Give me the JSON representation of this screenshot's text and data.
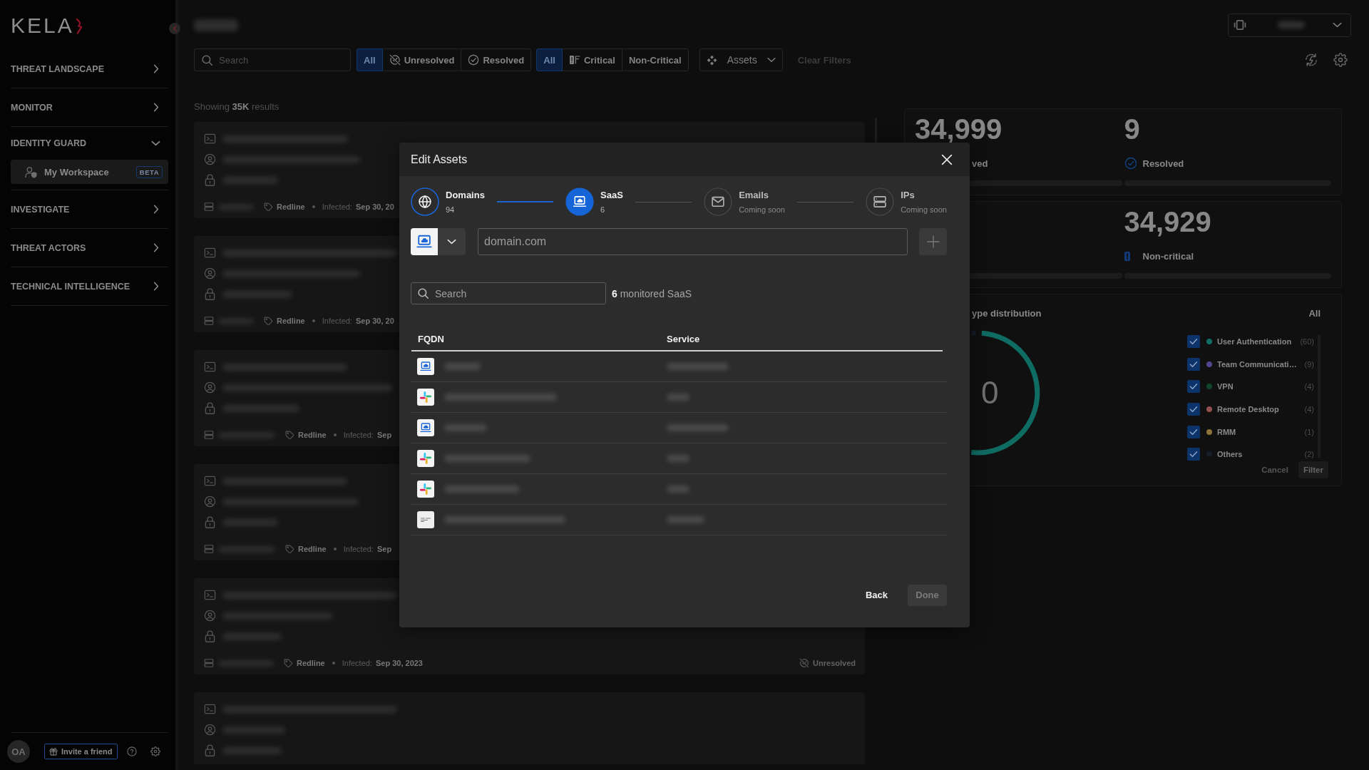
{
  "sidebar": {
    "logo": "KELA",
    "items": [
      {
        "label": "THREAT LANDSCAPE",
        "expanded": false
      },
      {
        "label": "MONITOR",
        "expanded": false
      },
      {
        "label": "IDENTITY GUARD",
        "expanded": true,
        "children": [
          {
            "label": "My Workspace",
            "badge": "BETA",
            "selected": true
          }
        ]
      },
      {
        "label": "INVESTIGATE",
        "expanded": false
      },
      {
        "label": "THREAT ACTORS",
        "expanded": false
      },
      {
        "label": "TECHNICAL INTELLIGENCE",
        "expanded": false
      }
    ],
    "footer": {
      "avatar": "OA",
      "invite": "Invite a friend"
    }
  },
  "filters": {
    "search": {
      "placeholder": "Search"
    },
    "status": [
      {
        "label": "All",
        "kind": "text",
        "selected": true
      },
      {
        "label": "Unresolved",
        "kind": "unresolved",
        "selected": false
      },
      {
        "label": "Resolved",
        "kind": "resolved",
        "selected": false
      }
    ],
    "severity": [
      {
        "label": "All",
        "kind": "text",
        "selected": true
      },
      {
        "label": "Critical",
        "kind": "critical",
        "selected": false
      },
      {
        "label": "Non-Critical",
        "kind": "text",
        "selected": false
      }
    ],
    "assets": {
      "label": "Assets"
    },
    "clear": {
      "label": "Clear Filters",
      "disabled": true
    }
  },
  "results": {
    "summary": "Showing **35K** results",
    "cards": [
      {
        "fields": [
          {
            "kind": "link"
          },
          {
            "kind": "account"
          },
          {
            "kind": "password"
          }
        ],
        "footer": {
          "source": "Redline",
          "infected_label": "Infected:",
          "infected_date": "Sep 30, 20"
        }
      },
      {
        "fields": [
          {
            "kind": "link"
          },
          {
            "kind": "account"
          },
          {
            "kind": "password"
          }
        ],
        "footer": {
          "source": "Redline",
          "infected_label": "Infected:",
          "infected_date": "Sep 30, 20"
        }
      },
      {
        "fields": [
          {
            "kind": "link"
          },
          {
            "kind": "account"
          },
          {
            "kind": "password"
          }
        ],
        "footer": {
          "source": "Redline",
          "infected_label": "Infected:",
          "infected_date": "Sep"
        }
      },
      {
        "fields": [
          {
            "kind": "link"
          },
          {
            "kind": "account"
          },
          {
            "kind": "password"
          }
        ],
        "footer": {
          "source": "Redline",
          "infected_label": "Infected:",
          "infected_date": "Sep"
        }
      },
      {
        "fields": [
          {
            "kind": "link"
          },
          {
            "kind": "account"
          },
          {
            "kind": "password"
          }
        ],
        "footer": {
          "source": "Redline",
          "infected_label": "Infected:",
          "infected_date": "Sep 30, 2023",
          "status": "Unresolved"
        }
      },
      {
        "fields": [
          {
            "kind": "link"
          },
          {
            "kind": "account"
          },
          {
            "kind": "password"
          }
        ]
      }
    ]
  },
  "stats": [
    {
      "left": {
        "value": "34,999",
        "label": "ved"
      },
      "right": {
        "value": "9",
        "label": "Resolved",
        "kind": "resolved"
      }
    },
    {
      "right": {
        "value": "34,929",
        "label": "Non-critical",
        "kind": "noncritical"
      }
    }
  ],
  "distribution": {
    "title": "ype distribution",
    "filter": "All",
    "total": "0",
    "legend": [
      {
        "label": "User Authentication",
        "count": "(60)",
        "color": "#0f6c63",
        "checked": true
      },
      {
        "label": "Team Communicati…",
        "count": "(9)",
        "color": "#4f4590",
        "checked": true
      },
      {
        "label": "VPN",
        "count": "(4)",
        "color": "#10472a",
        "checked": true
      },
      {
        "label": "Remote Desktop",
        "count": "(4)",
        "color": "#924f4f",
        "checked": true
      },
      {
        "label": "RMM",
        "count": "(1)",
        "color": "#8c733a",
        "checked": true
      },
      {
        "label": "Others",
        "count": "(2)",
        "color": "#141c28",
        "checked": true
      }
    ],
    "actions": [
      {
        "label": "Cancel",
        "kind": "text",
        "disabled": true
      },
      {
        "label": "Filter",
        "kind": "filled",
        "disabled": true
      }
    ]
  },
  "modal": {
    "title": "Edit Assets",
    "steps": [
      {
        "label": "Domains",
        "note": "94",
        "kind": "globe",
        "completed": true,
        "selected": false,
        "disabled": false
      },
      {
        "label": "SaaS",
        "note": "6",
        "kind": "saas",
        "completed": false,
        "selected": true,
        "disabled": false
      },
      {
        "label": "Emails",
        "note": "Coming soon",
        "kind": "email",
        "completed": false,
        "selected": false,
        "disabled": true
      },
      {
        "label": "IPs",
        "note": "Coming soon",
        "kind": "ip",
        "completed": false,
        "selected": false,
        "disabled": true
      }
    ],
    "domain_input": {
      "placeholder": "domain.com"
    },
    "search": {
      "placeholder": "Search"
    },
    "count": "**6** monitored SaaS",
    "columns": [
      "FQDN",
      "Service"
    ],
    "rows": [
      {
        "kind": "custom"
      },
      {
        "kind": "slack"
      },
      {
        "kind": "custom"
      },
      {
        "kind": "slack"
      },
      {
        "kind": "slack"
      },
      {
        "kind": "netsuite"
      }
    ],
    "buttons": [
      {
        "label": "Back",
        "kind": "text",
        "disabled": false
      },
      {
        "label": "Done",
        "kind": "filled",
        "disabled": true
      }
    ]
  }
}
